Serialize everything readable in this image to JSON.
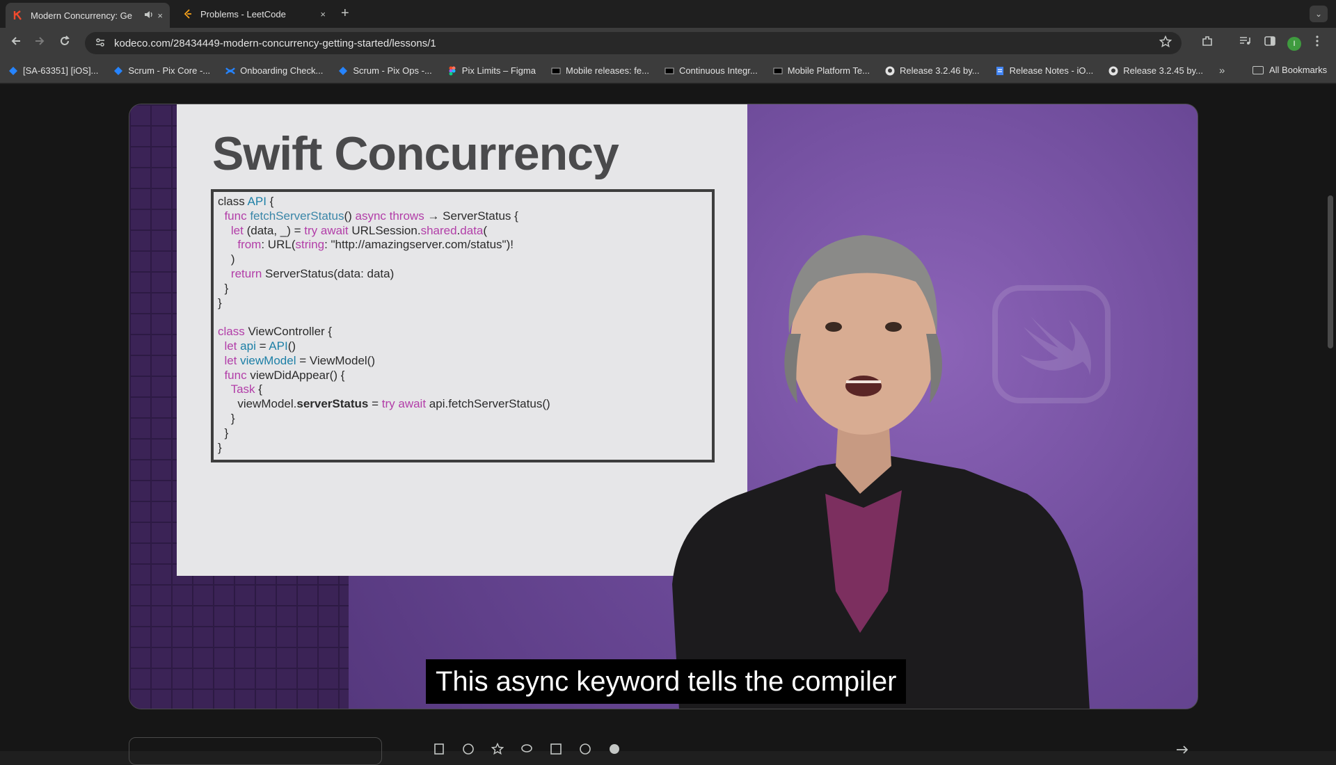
{
  "browser": {
    "tabs": [
      {
        "title": "Modern Concurrency: Ge",
        "active": true,
        "favicon": "kodeco-icon",
        "audio_icon": "speaker-icon",
        "close": "×"
      },
      {
        "title": "Problems - LeetCode",
        "active": false,
        "favicon": "leetcode-icon",
        "close": "×"
      }
    ],
    "new_tab": "+",
    "tab_menu": "⌄",
    "url": "kodeco.com/28434449-modern-concurrency-getting-started/lessons/1",
    "profile_initial": "I"
  },
  "bookmarks": [
    {
      "label": "[SA-63351] [iOS]...",
      "icon": "jira-icon"
    },
    {
      "label": "Scrum - Pix Core -...",
      "icon": "jira-icon"
    },
    {
      "label": "Onboarding Check...",
      "icon": "confluence-icon"
    },
    {
      "label": "Scrum - Pix Ops -...",
      "icon": "jira-icon"
    },
    {
      "label": "Pix Limits – Figma",
      "icon": "figma-icon"
    },
    {
      "label": "Mobile releases: fe...",
      "icon": "app-icon"
    },
    {
      "label": "Continuous Integr...",
      "icon": "app-icon"
    },
    {
      "label": "Mobile Platform Te...",
      "icon": "app-icon"
    },
    {
      "label": "Release 3.2.46 by...",
      "icon": "github-icon"
    },
    {
      "label": "Release Notes - iO...",
      "icon": "docs-icon"
    },
    {
      "label": "Release 3.2.45 by...",
      "icon": "github-icon"
    }
  ],
  "bookmarks_more": "»",
  "bookmarks_all": "All Bookmarks",
  "slide": {
    "title": "Swift Concurrency"
  },
  "caption": "This async keyword tells the compiler",
  "colors": {
    "keyword": "#b23ea8",
    "type": "#1c7fa6",
    "purple_bg": "#6a4896"
  }
}
